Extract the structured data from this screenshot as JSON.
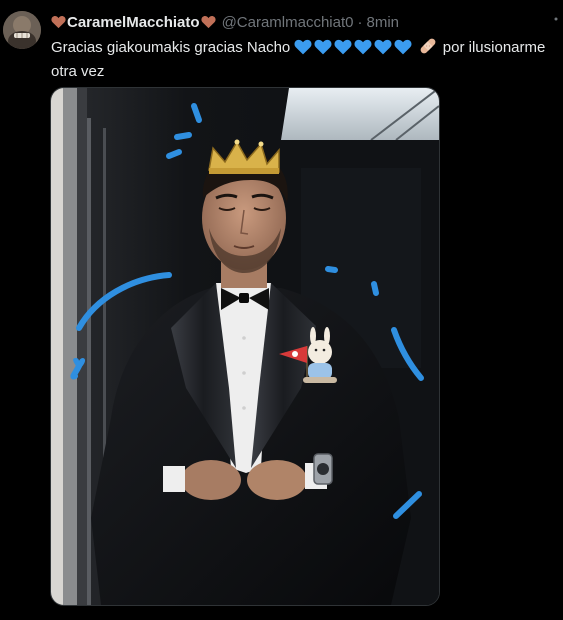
{
  "tweet": {
    "display_name": "CaramelMacchiato",
    "handle": "@Caramlmacchiat0",
    "separator": "·",
    "timestamp": "8min",
    "text_before_emojis": "Gracias giakoumakis gracias Nacho",
    "text_after_emojis": "por ilusionarme otra vez",
    "emojis": [
      "blue-heart",
      "blue-heart",
      "blue-heart",
      "blue-heart",
      "blue-heart",
      "blue-heart",
      "adhesive-bandage"
    ],
    "name_emoji": "brown-heart"
  },
  "colors": {
    "background": "#000000",
    "text_primary": "#e7e9ea",
    "text_secondary": "#71767b",
    "blue_heart": "#3b9cf0",
    "brown_heart": "#c07058",
    "doodle_blue": "#2f8fe0",
    "crown_gold": "#d9b24a"
  }
}
